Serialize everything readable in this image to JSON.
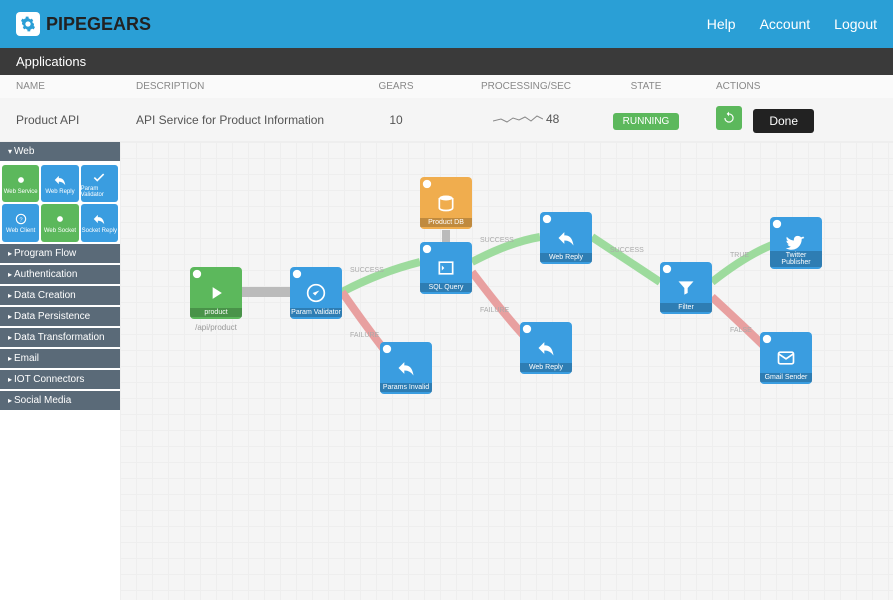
{
  "brand": "PIPEGEARS",
  "header": {
    "help": "Help",
    "account": "Account",
    "logout": "Logout"
  },
  "subheader": "Applications",
  "columns": {
    "name": "NAME",
    "description": "DESCRIPTION",
    "gears": "GEARS",
    "processing": "PROCESSING/SEC",
    "state": "STATE",
    "actions": "ACTIONS"
  },
  "row": {
    "name": "Product API",
    "description": "API Service for Product Information",
    "gears": "10",
    "processing": "48",
    "state": "RUNNING",
    "done": "Done"
  },
  "sidebar": {
    "sections": [
      {
        "label": "Web",
        "open": true
      },
      {
        "label": "Program Flow"
      },
      {
        "label": "Authentication"
      },
      {
        "label": "Data Creation"
      },
      {
        "label": "Data Persistence"
      },
      {
        "label": "Data Transformation"
      },
      {
        "label": "Email"
      },
      {
        "label": "IOT Connectors"
      },
      {
        "label": "Social Media"
      }
    ],
    "web_tiles": [
      {
        "label": "Web Service",
        "color": "green"
      },
      {
        "label": "Web Reply",
        "color": "blue"
      },
      {
        "label": "Param Validator",
        "color": "blue"
      },
      {
        "label": "Web Client",
        "color": "blue"
      },
      {
        "label": "Web Socket",
        "color": "green"
      },
      {
        "label": "Socket Reply",
        "color": "blue"
      }
    ]
  },
  "nodes": {
    "start": {
      "label": "product",
      "sublabel": "/api/product"
    },
    "validator": {
      "label": "Param Validator"
    },
    "invalid": {
      "label": "Params Invalid"
    },
    "sql": {
      "label": "SQL Query"
    },
    "db": {
      "label": "Product DB"
    },
    "reply1": {
      "label": "Web Reply"
    },
    "reply2": {
      "label": "Web Reply"
    },
    "filter": {
      "label": "Filter"
    },
    "twitter": {
      "label": "Twitter Publisher"
    },
    "gmail": {
      "label": "Gmail Sender"
    }
  },
  "edges": {
    "success": "SUCCESS",
    "failure": "FAILURE",
    "true": "TRUE",
    "false": "FALSE"
  }
}
